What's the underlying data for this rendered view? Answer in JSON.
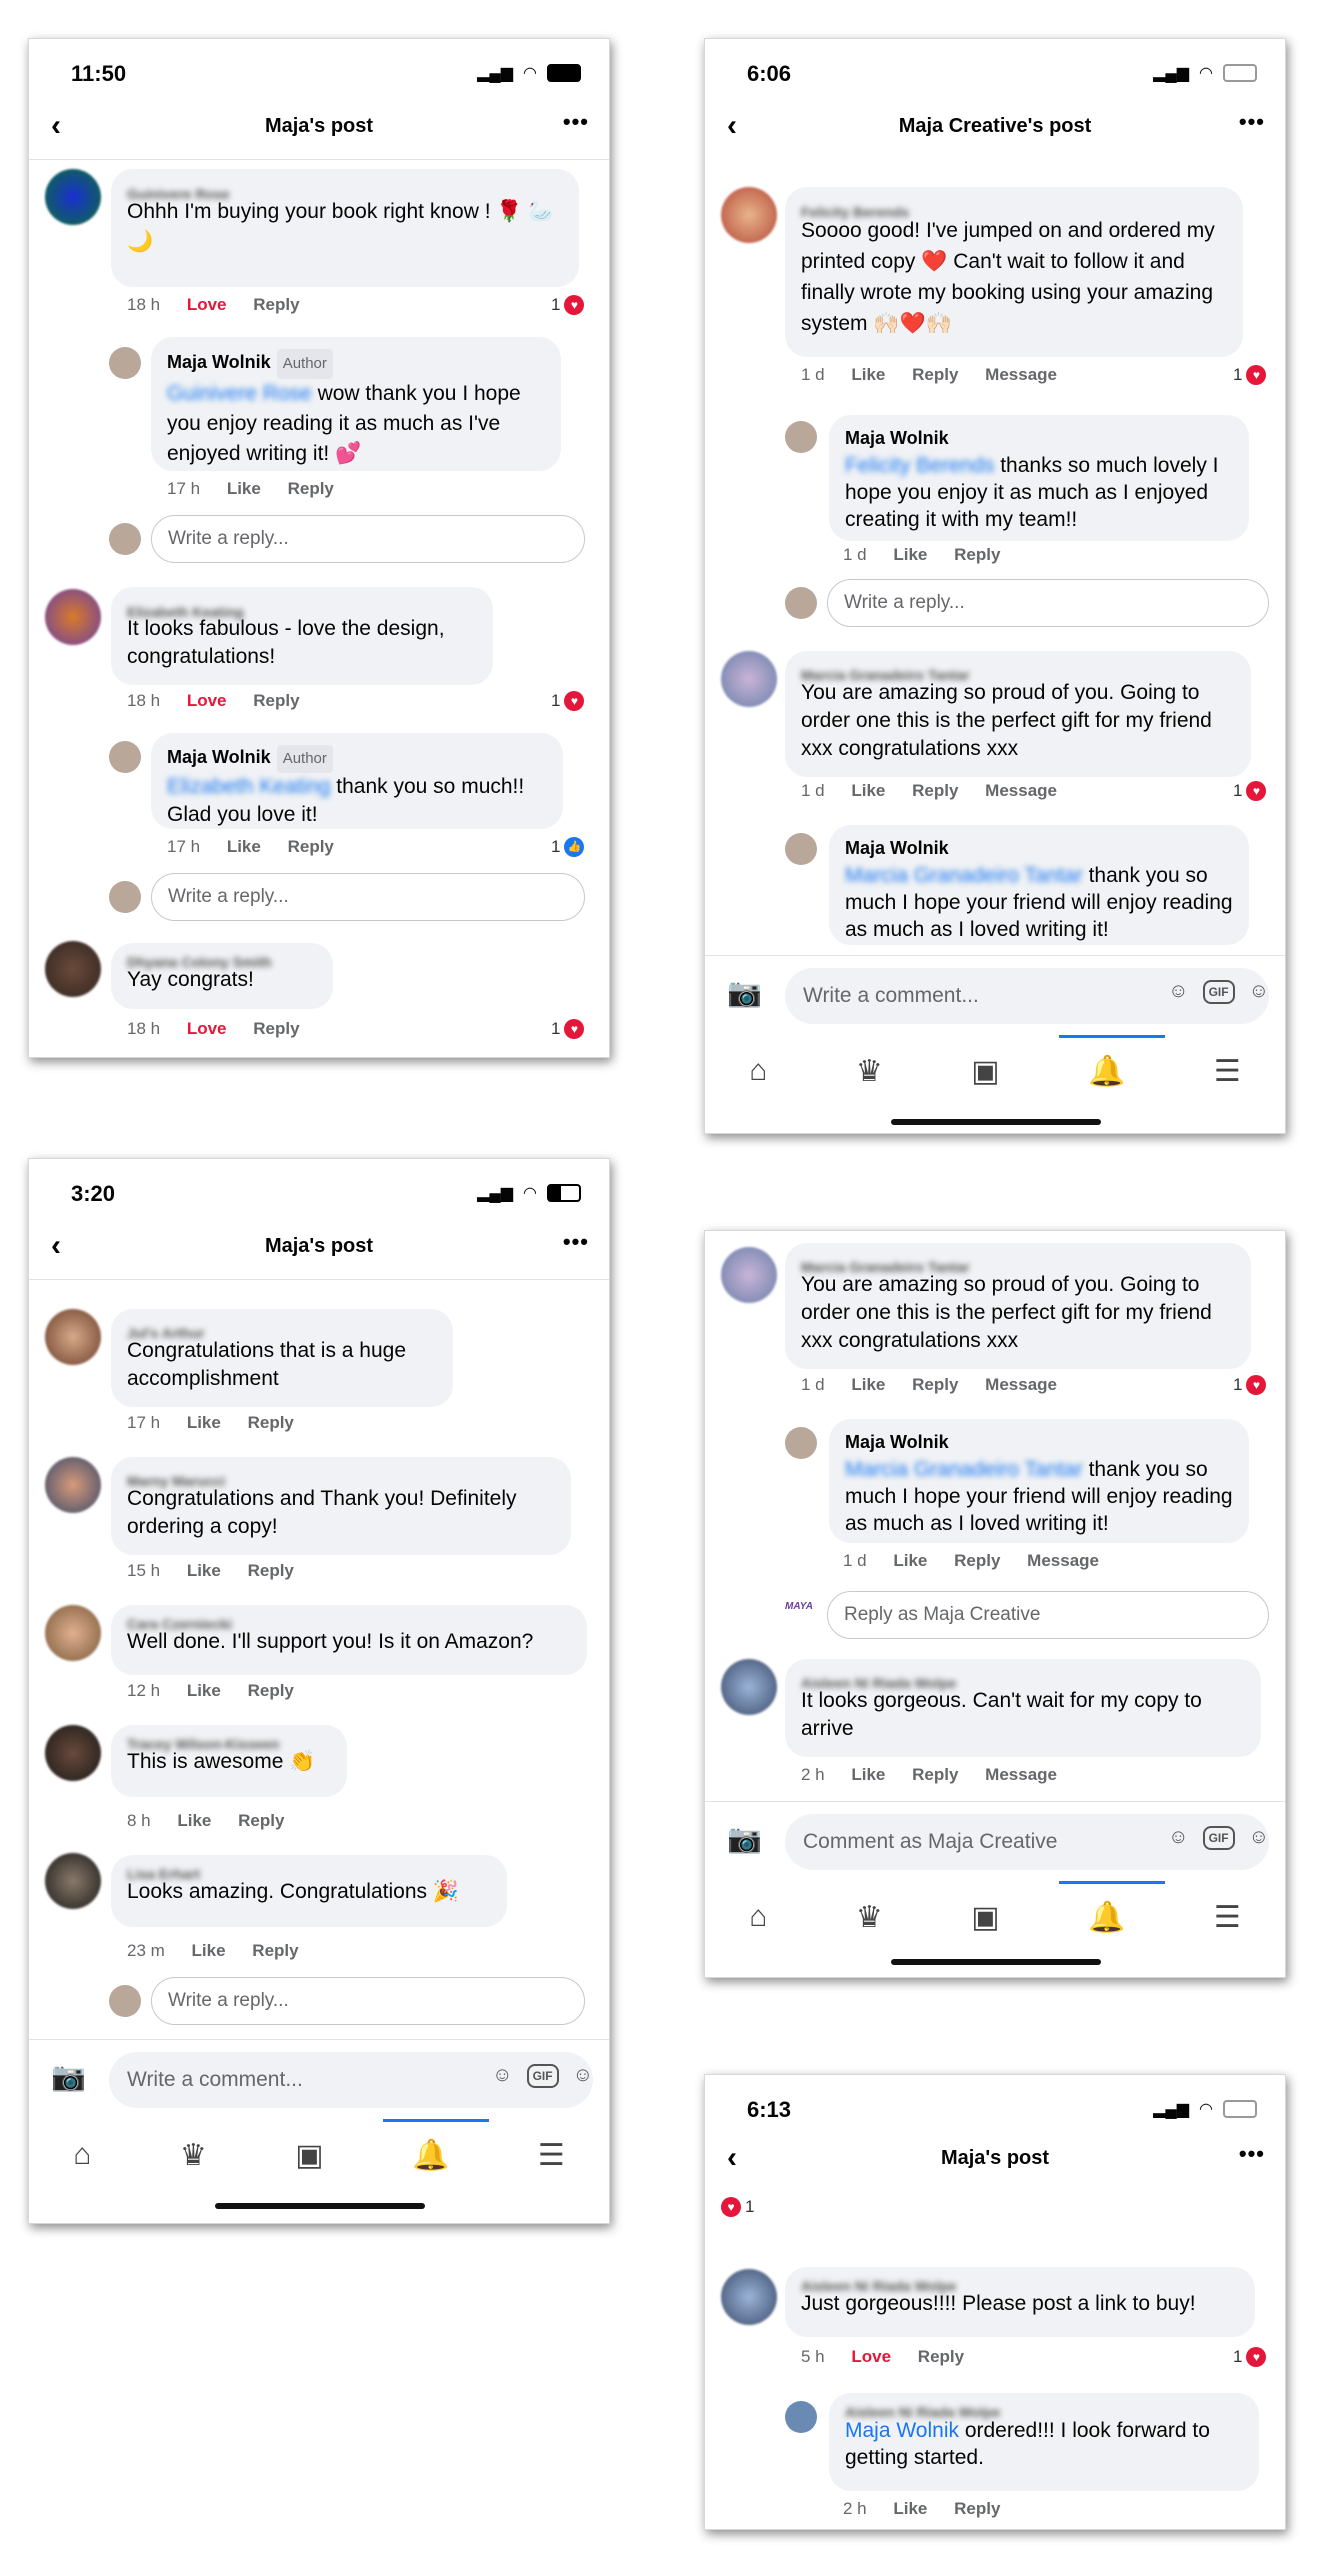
{
  "shot1": {
    "time": "11:50",
    "title": "Maja's post",
    "comments": [
      {
        "name": "Guinivere Rose",
        "text": "Ohhh I'm buying your book right know ! 🌹 🦢🌙",
        "ts": "18 h",
        "act1": "Love",
        "act2": "Reply",
        "count": "1"
      },
      {
        "name": "Maja Wolnik",
        "badge": "Author",
        "mention": "Guinivere Rose",
        "text": " wow thank you I hope you enjoy reading it as much as I've enjoyed writing it! 💕",
        "ts": "17 h",
        "act1": "Like",
        "act2": "Reply"
      },
      {
        "name": "Elizabeth Keating",
        "text": "It looks fabulous - love the design, congratulations!",
        "ts": "18 h",
        "act1": "Love",
        "act2": "Reply",
        "count": "1"
      },
      {
        "name": "Maja Wolnik",
        "badge": "Author",
        "mention": "Elizabeth Keating",
        "text": " thank you so much!! Glad you love it!",
        "ts": "17 h",
        "act1": "Like",
        "act2": "Reply",
        "count": "1"
      },
      {
        "name": "Dhyana Colony Smith",
        "text": "Yay congrats!",
        "ts": "18 h",
        "act1": "Love",
        "act2": "Reply",
        "count": "1"
      }
    ],
    "reply_placeholder": "Write a reply..."
  },
  "shot2": {
    "time": "6:06",
    "title": "Maja Creative's post",
    "comments": [
      {
        "name": "Felicity Berends",
        "text": "Soooo good!  I've jumped on and ordered my printed copy ❤️ Can't wait to follow it and finally wrote my booking using your amazing system 🙌🏻❤️🙌🏻",
        "ts": "1 d",
        "act1": "Like",
        "act2": "Reply",
        "act3": "Message",
        "count": "1"
      },
      {
        "name": "Maja Wolnik",
        "mention": "Felicity Berends",
        "text": " thanks so much lovely I hope you enjoy it as much as I enjoyed creating it with my team!!",
        "ts": "1 d",
        "act1": "Like",
        "act2": "Reply"
      },
      {
        "name": "Marcia Granadeiro Tantar",
        "text": "You are amazing so proud of you. Going to order one this is the perfect gift for my friend xxx congratulations xxx",
        "ts": "1 d",
        "act1": "Like",
        "act2": "Reply",
        "act3": "Message",
        "count": "1"
      },
      {
        "name": "Maja Wolnik",
        "mention": "Marcia Granadeiro Tantar",
        "text": " thank you so much I hope your friend will enjoy reading as much as I loved writing it!"
      }
    ],
    "reply_placeholder": "Write a reply...",
    "composer_placeholder": "Write a comment...",
    "gif": "GIF"
  },
  "shot3": {
    "time": "3:20",
    "title": "Maja's post",
    "comments": [
      {
        "name": "Jul's Arthur",
        "text": "Congratulations that is a huge accomplishment",
        "ts": "17 h",
        "act1": "Like",
        "act2": "Reply"
      },
      {
        "name": "Marny Marucci",
        "text": "Congratulations and Thank you! Definitely ordering a copy!",
        "ts": "15 h",
        "act1": "Like",
        "act2": "Reply"
      },
      {
        "name": "Cara Czerniecki",
        "text": "Well done. I'll support you! Is it on Amazon?",
        "ts": "12 h",
        "act1": "Like",
        "act2": "Reply"
      },
      {
        "name": "Tracey Wilson-Kisseen",
        "text": "This is awesome 👏",
        "ts": "8 h",
        "act1": "Like",
        "act2": "Reply"
      },
      {
        "name": "Lisa Erhart",
        "text": "Looks amazing. Congratulations 🎉",
        "ts": "23 m",
        "act1": "Like",
        "act2": "Reply"
      }
    ],
    "reply_placeholder": "Write a reply...",
    "composer_placeholder": "Write a comment...",
    "gif": "GIF"
  },
  "shot4": {
    "comments": [
      {
        "name": "Marcia Granadeiro Tantar",
        "text": "You are amazing so proud of you. Going to order one this is the perfect gift for my friend xxx congratulations xxx",
        "ts": "1 d",
        "act1": "Like",
        "act2": "Reply",
        "act3": "Message",
        "count": "1"
      },
      {
        "name": "Maja Wolnik",
        "mention": "Marcia Granadeiro Tantar",
        "text": " thank you so much I hope your friend will enjoy reading as much as I loved writing it!",
        "ts": "1 d",
        "act1": "Like",
        "act2": "Reply",
        "act3": "Message"
      },
      {
        "name": "Aisleen Ni Riada Wolpe",
        "text": "It looks gorgeous. Can't wait for my copy to arrive",
        "ts": "2 h",
        "act1": "Like",
        "act2": "Reply",
        "act3": "Message"
      }
    ],
    "reply_placeholder": "Reply as Maja Creative",
    "composer_placeholder": "Comment as Maja Creative",
    "gif": "GIF",
    "page_logo": "MAYA"
  },
  "shot5": {
    "time": "6:13",
    "title": "Maja's post",
    "post_reactions": "1",
    "comments": [
      {
        "name": "Aisleen Ni Riada Wolpe",
        "text": "Just gorgeous!!!! Please post a link to buy!",
        "ts": "5 h",
        "act1": "Love",
        "act2": "Reply",
        "count": "1"
      },
      {
        "name": "Aisleen Ni Riada Wolpe",
        "mention": "Maja Wolnik",
        "text": " ordered!!! I look forward to getting started.",
        "ts": "2 h",
        "act1": "Like",
        "act2": "Reply"
      }
    ]
  },
  "colors": {
    "accent": "#1877f2",
    "love": "#e4173a",
    "bubble": "#f0f2f5"
  }
}
